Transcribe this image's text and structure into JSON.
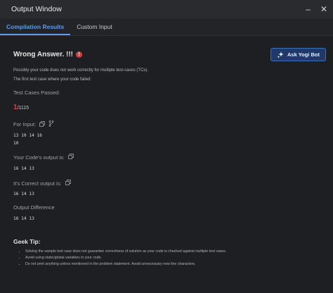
{
  "window": {
    "title": "Output Window"
  },
  "tabs": [
    {
      "label": "Compilation Results",
      "active": true
    },
    {
      "label": "Custom Input",
      "active": false
    }
  ],
  "verdict": {
    "text": "Wrong Answer. !!!",
    "badge": "!"
  },
  "ask_button": {
    "label": "Ask Yogi Bot"
  },
  "hints": [
    "Possibly your code does not work correctly for multiple test-cases (TCs).",
    "The first test case where your code failed:"
  ],
  "tests": {
    "label": "Test Cases Passed:",
    "passed": "1",
    "total": "/1115"
  },
  "for_input": {
    "label": "For Input:",
    "line1": "13 10 14 16",
    "line2": "10"
  },
  "your_output": {
    "label": "Your Code's output is:",
    "value": "16 14 13"
  },
  "correct_output": {
    "label": "It's Correct output is:",
    "value": "16 14 13"
  },
  "difference": {
    "label": "Output Difference",
    "value": "16 14 13"
  },
  "geek_tip": {
    "title": "Geek Tip:",
    "items": [
      "Solving the sample test case does not guarantee correctness of solution as your code is checked against multiple test cases.",
      "Avoid using static/global variables in your code.",
      "Do not print anything unless mentioned in the problem statement. Avoid unnecessary new line characters."
    ]
  },
  "colors": {
    "accent": "#5b9bf0",
    "error": "#e03b3b",
    "button_bg": "#1f3a6a"
  }
}
